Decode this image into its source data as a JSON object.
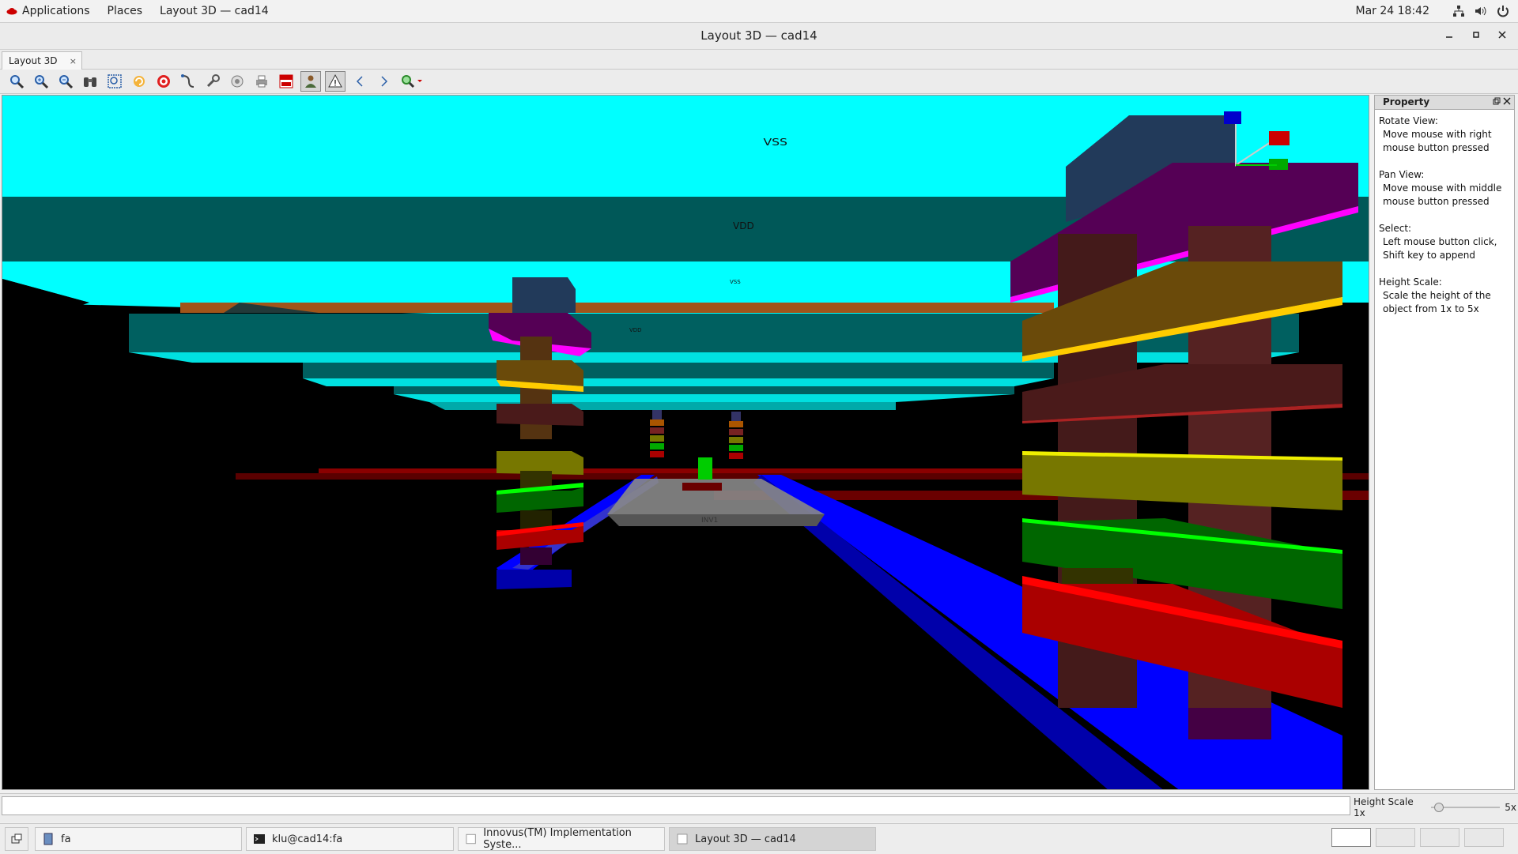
{
  "topbar": {
    "applications": "Applications",
    "places": "Places",
    "window_menu": "Layout 3D — cad14",
    "datetime": "Mar 24  18:42"
  },
  "window": {
    "title": "Layout 3D — cad14"
  },
  "tab": {
    "label": "Layout 3D",
    "close": "×"
  },
  "toolbar": {
    "icons": [
      "zoom-icon",
      "zoom-in-icon",
      "zoom-out-icon",
      "binoculars-icon",
      "fit-view-icon",
      "refresh-icon",
      "target-icon",
      "route-icon",
      "tool-icon",
      "reset-icon",
      "print-icon",
      "gif-icon",
      "person-icon",
      "warning-icon",
      "arrow-left-icon",
      "arrow-right-icon",
      "zoom-select-icon"
    ]
  },
  "scene": {
    "labels": {
      "vss": "VSS",
      "vdd": "VDD",
      "small1": "VSS",
      "small2": "VDD",
      "center": "INV1"
    },
    "colors": {
      "sky": "#00ffff",
      "teal": "#005555",
      "black": "#000000",
      "blue": "#0000ff",
      "red": "#ff0000",
      "green": "#00ff00",
      "olive": "#777700",
      "magenta": "#ff00ff",
      "purple": "#550055",
      "orange": "#aa5500",
      "brown": "#553311"
    }
  },
  "panel": {
    "title": "Property",
    "sections": [
      {
        "title": "Rotate View:",
        "desc": "Move mouse with right mouse button pressed"
      },
      {
        "title": "Pan View:",
        "desc": "Move mouse with middle mouse button pressed"
      },
      {
        "title": "Select:",
        "desc": "Left mouse button click, Shift key to append"
      },
      {
        "title": "Height Scale:",
        "desc": "Scale the height of the object from 1x to 5x"
      }
    ]
  },
  "status": {
    "command_value": "",
    "height_scale_label": "Height Scale 1x",
    "height_scale_max": "5x",
    "height_scale_value": 1
  },
  "taskbar": {
    "items": [
      {
        "label": "fa"
      },
      {
        "label": "klu@cad14:fa"
      },
      {
        "label": "Innovus(TM) Implementation Syste..."
      },
      {
        "label": "Layout 3D — cad14"
      }
    ]
  }
}
